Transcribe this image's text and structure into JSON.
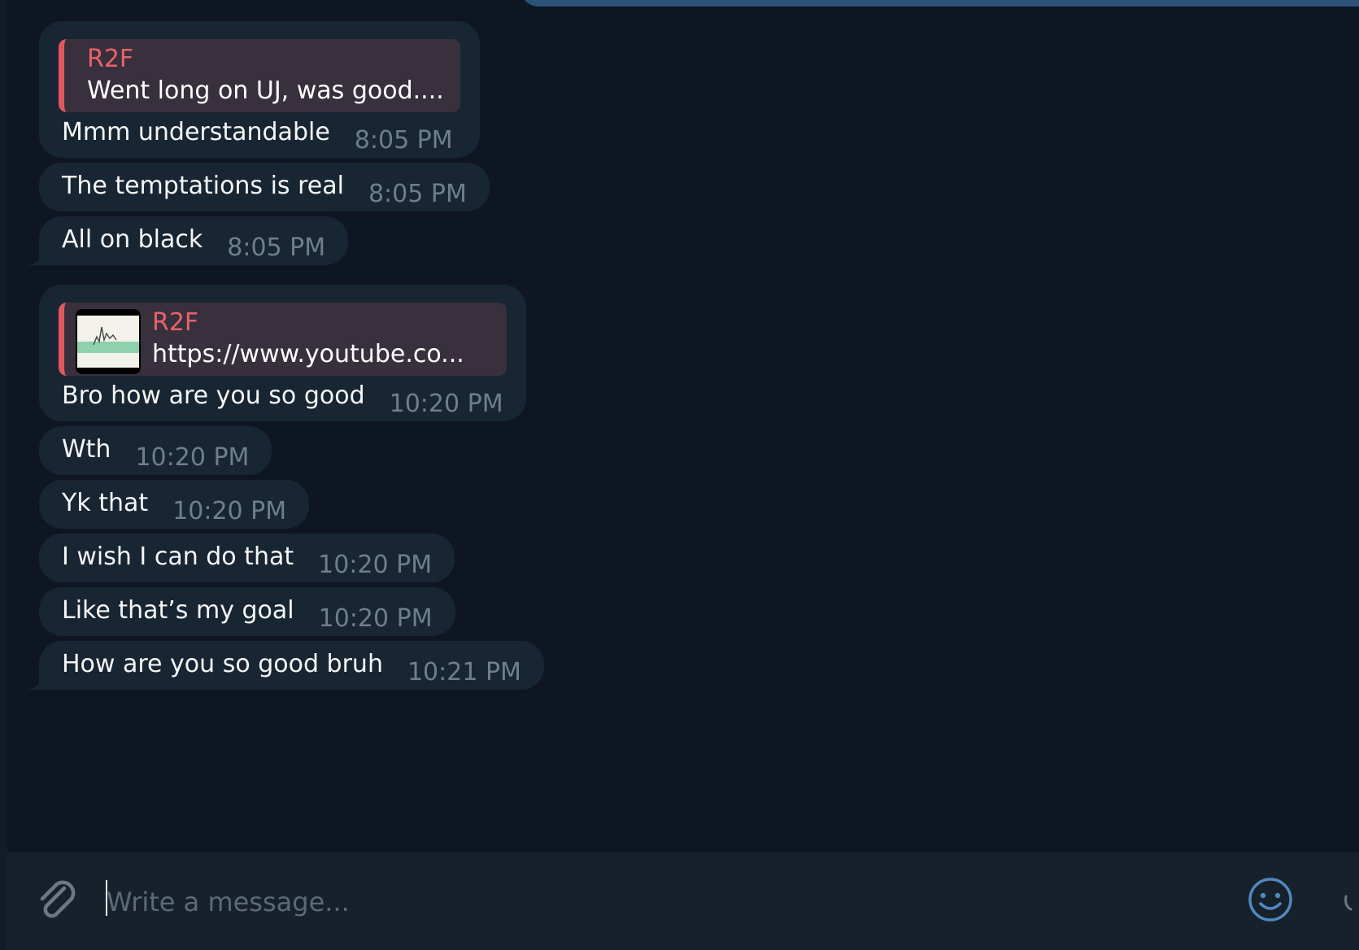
{
  "colors": {
    "background": "#0e1621",
    "bubble": "#182533",
    "reply_accent": "#e0585f",
    "reply_author": "#e8626a",
    "time": "#6d7f8f",
    "composer": "#17212b",
    "icon": "#6c7883",
    "emoji_icon": "#5288c1"
  },
  "messages": [
    {
      "reply": {
        "author": "R2F",
        "text": "Went long on UJ, was good...."
      },
      "text": "Mmm understandable",
      "time": "8:05 PM"
    },
    {
      "text": "The temptations is real",
      "time": "8:05 PM"
    },
    {
      "text": "All on black",
      "time": "8:05 PM"
    },
    {
      "reply": {
        "author": "R2F",
        "text": "https://www.youtube.co...",
        "thumbnail": "chart-thumbnail"
      },
      "text": "Bro how are you so good",
      "time": "10:20 PM"
    },
    {
      "text": "Wth",
      "time": "10:20 PM"
    },
    {
      "text": "Yk that",
      "time": "10:20 PM"
    },
    {
      "text": "I wish I can do that",
      "time": "10:20 PM"
    },
    {
      "text": "Like that’s my goal",
      "time": "10:20 PM"
    },
    {
      "text": "How are you so good bruh",
      "time": "10:21 PM"
    }
  ],
  "composer": {
    "placeholder": "Write a message...",
    "value": "",
    "attach_icon": "paperclip-icon",
    "emoji_icon": "smiley-icon"
  }
}
